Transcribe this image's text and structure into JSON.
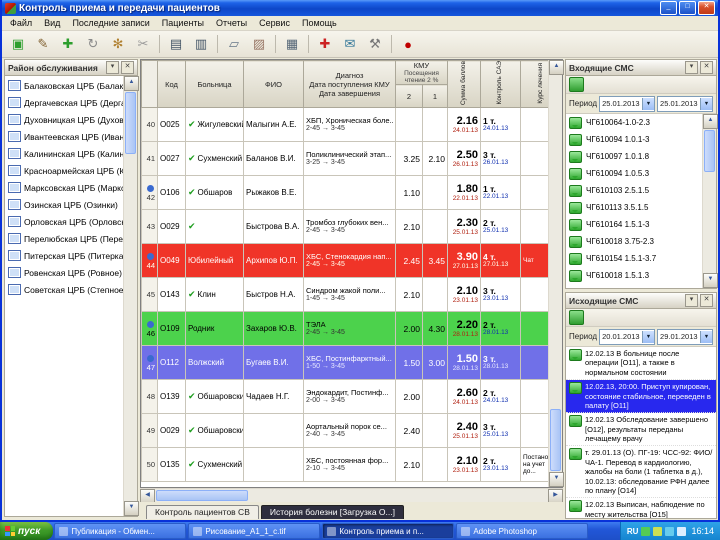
{
  "window": {
    "title": "Контроль приема и передачи пациентов",
    "controls": {
      "minimize": "_",
      "maximize": "□",
      "close": "✕"
    }
  },
  "menu": {
    "items": [
      "Файл",
      "Вид",
      "Последние записи",
      "Пациенты",
      "Отчеты",
      "Сервис",
      "Помощь"
    ]
  },
  "toolbar": {
    "icons": [
      {
        "name": "database-icon",
        "glyph": "▣",
        "color": "#2D9E2D"
      },
      {
        "name": "edit-record-icon",
        "glyph": "✎",
        "color": "#806030"
      },
      {
        "name": "add-record-icon",
        "glyph": "✚",
        "color": "#2D9E2D"
      },
      {
        "name": "refresh-icon",
        "glyph": "↻",
        "color": "#8A8A8A"
      },
      {
        "name": "wand-icon",
        "glyph": "✻",
        "color": "#B08030"
      },
      {
        "name": "cut-icon",
        "glyph": "✂",
        "color": "#999999"
      },
      {
        "name": "print-icon",
        "glyph": "▤",
        "color": "#445566"
      },
      {
        "name": "print-preview-icon",
        "glyph": "▥",
        "color": "#445566"
      },
      {
        "name": "copy-icon",
        "glyph": "▱",
        "color": "#667788"
      },
      {
        "name": "paste-icon",
        "glyph": "▨",
        "color": "#997766"
      },
      {
        "name": "card-view-icon",
        "glyph": "▦",
        "color": "#556677"
      },
      {
        "name": "first-aid-icon",
        "glyph": "✚",
        "color": "#CC2222"
      },
      {
        "name": "mail-icon",
        "glyph": "✉",
        "color": "#337799"
      },
      {
        "name": "tools-icon",
        "glyph": "⚒",
        "color": "#777777"
      },
      {
        "name": "stop-icon",
        "glyph": "●",
        "color": "#C00000"
      }
    ]
  },
  "left_panel": {
    "title": "Район обслуживания",
    "items": [
      "Балаковская ЦРБ (Балаково)",
      "Дергачевская ЦРБ (Дергачи)",
      "Духовницкая ЦРБ (Духовницкое)",
      "Ивантеевская ЦРБ (Ивантеевка)",
      "Калининская ЦРБ (Калининск)",
      "Красноармейская ЦРБ (Красноарм.)",
      "Марксовская ЦРБ (Маркс)",
      "Озинская ЦРБ (Озинки)",
      "Орловская ЦРБ (Орловское)",
      "Перелюбская ЦРБ (Перелюб)",
      "Питерская ЦРБ (Питерка)",
      "Ровенская ЦРБ (Ровное)",
      "Советская ЦРБ (Степное)"
    ]
  },
  "table": {
    "highlight_colors": {
      "red": "#F03428",
      "green": "#4CD24C",
      "blue": "#7070E8"
    },
    "header": {
      "num": "",
      "code": "Код",
      "hospital": "Больница",
      "fio": "ФИО",
      "diagnosis": "Диагноз\nДата поступления КМУ\nДата завершения",
      "kmu_group": "КМУ",
      "kmu_sub": "Посещения чтение 2 %",
      "kmu2": "2",
      "kmu1": "1",
      "score": "Сумма баллов",
      "tariff": "Контроль САЭ",
      "extra": "Курс лечения"
    },
    "rows": [
      {
        "num": "40",
        "icon": false,
        "code": "О025",
        "check": true,
        "hospital": "Жигулевский",
        "fio": "Малыгин А.Е.",
        "diagnosis": "ХБП, Хроническая боле...",
        "dates": "2-45 → 3-45",
        "kmu2": "",
        "kmu1": "",
        "score": "2.16",
        "score_date": "24.01.13",
        "tariff": "1 т.",
        "tariff_date": "24.01.13",
        "extra": "",
        "hl": ""
      },
      {
        "num": "41",
        "icon": false,
        "code": "О027",
        "check": true,
        "hospital": "Сухменский",
        "fio": "Баланов В.И.",
        "diagnosis": "Поликлинический этап...",
        "dates": "3-25 → 3-45",
        "kmu2": "3.25",
        "kmu1": "2.10",
        "score": "2.50",
        "score_date": "26.01.13",
        "tariff": "3 т.",
        "tariff_date": "26.01.13",
        "extra": "",
        "hl": ""
      },
      {
        "num": "42",
        "icon": true,
        "code": "О106",
        "check": true,
        "hospital": "Обшаров",
        "fio": "Рыжаков В.Е.",
        "diagnosis": "",
        "dates": "",
        "kmu2": "1.10",
        "kmu1": "",
        "score": "1.80",
        "score_date": "22.01.13",
        "tariff": "1 т.",
        "tariff_date": "22.01.13",
        "extra": "",
        "hl": ""
      },
      {
        "num": "43",
        "icon": false,
        "code": "О029",
        "check": true,
        "hospital": "",
        "fio": "Быстрова В.А.",
        "diagnosis": "Тромбоз глубоких вен...",
        "dates": "2-45 → 3-45",
        "kmu2": "2.10",
        "kmu1": "",
        "score": "2.30",
        "score_date": "25.01.13",
        "tariff": "2 т.",
        "tariff_date": "25.01.13",
        "extra": "",
        "hl": ""
      },
      {
        "num": "44",
        "icon": true,
        "code": "О049",
        "check": false,
        "hospital": "Юбилейный",
        "fio": "Архипов Ю.П.",
        "diagnosis": "ХБС, Стенокардия нап...",
        "dates": "2-45 → 3-45",
        "kmu2": "2.45",
        "kmu1": "3.45",
        "score": "3.90",
        "score_date": "27.01.13",
        "tariff": "4 т.",
        "tariff_date": "27.01.13",
        "extra": "Чат",
        "hl": "red"
      },
      {
        "num": "45",
        "icon": false,
        "code": "О143",
        "check": true,
        "hospital": "Клин",
        "fio": "Быстров Н.А.",
        "diagnosis": "Синдром жакой поли...",
        "dates": "1-45 → 3-45",
        "kmu2": "2.10",
        "kmu1": "",
        "score": "2.10",
        "score_date": "23.01.13",
        "tariff": "3 т.",
        "tariff_date": "23.01.13",
        "extra": "",
        "hl": ""
      },
      {
        "num": "46",
        "icon": true,
        "code": "О109",
        "check": false,
        "hospital": "Родник",
        "fio": "Захаров Ю.В.",
        "diagnosis": "ТЭЛА",
        "dates": "2-45 → 3-45",
        "kmu2": "2.00",
        "kmu1": "4.30",
        "score": "2.20",
        "score_date": "28.01.13",
        "tariff": "2 т.",
        "tariff_date": "28.01.13",
        "extra": "",
        "hl": "green"
      },
      {
        "num": "47",
        "icon": true,
        "code": "О112",
        "check": false,
        "hospital": "Волжский",
        "fio": "Бугаев В.И.",
        "diagnosis": "ХБС, Постинфарктный...",
        "dates": "1-50 → 3-45",
        "kmu2": "1.50",
        "kmu1": "3.00",
        "score": "1.50",
        "score_date": "28.01.13",
        "tariff": "3 т.",
        "tariff_date": "28.01.13",
        "extra": "",
        "hl": "blue"
      },
      {
        "num": "48",
        "icon": false,
        "code": "О139",
        "check": true,
        "hospital": "Обшаровский",
        "fio": "Чадаев Н.Г.",
        "diagnosis": "Эндокардит, Постинф...",
        "dates": "2-00 → 3-45",
        "kmu2": "2.00",
        "kmu1": "",
        "score": "2.60",
        "score_date": "24.01.13",
        "tariff": "2 т.",
        "tariff_date": "24.01.13",
        "extra": "",
        "hl": ""
      },
      {
        "num": "49",
        "icon": false,
        "code": "О029",
        "check": true,
        "hospital": "Обшаровский",
        "fio": "",
        "diagnosis": "Аортальный порок се...",
        "dates": "2-40 → 3-45",
        "kmu2": "2.40",
        "kmu1": "",
        "score": "2.40",
        "score_date": "25.01.13",
        "tariff": "3 т.",
        "tariff_date": "25.01.13",
        "extra": "",
        "hl": ""
      },
      {
        "num": "50",
        "icon": false,
        "code": "О135",
        "check": true,
        "hospital": "Сухменский",
        "fio": "",
        "diagnosis": "ХБС, постоянная фор...",
        "dates": "2-10 → 3-45",
        "kmu2": "2.10",
        "kmu1": "",
        "score": "2.10",
        "score_date": "23.01.13",
        "tariff": "2 т.",
        "tariff_date": "23.01.13",
        "extra": "Постановка на учет до...",
        "hl": ""
      }
    ]
  },
  "tabs": [
    {
      "label": "Контроль пациентов СВ",
      "active": false
    },
    {
      "label": "История болезни [Загрузка О...]",
      "active": true
    }
  ],
  "incoming_sms": {
    "title": "Входящие СМС",
    "period_label": "Период",
    "date_from": "25.01.2013",
    "date_to": "25.01.2013",
    "items": [
      "ЧГ610064-1.0-2.3",
      "ЧГ610094 1.0.1-3",
      "ЧГ610097 1.0.1.8",
      "ЧГ610094 1.0.5.3",
      "ЧГ610103 2.5.1.5",
      "ЧГ610113 3.5.1.5",
      "ЧГ610164 1.5.1-3",
      "ЧГ610018 3.75-2.3",
      "ЧГ610154 1.5.1-3.7",
      "ЧГ610018 1.5.1.3"
    ]
  },
  "outgoing_sms": {
    "title": "Исходящие СМС",
    "period_label": "Период",
    "date_from": "20.01.2013",
    "date_to": "29.01.2013",
    "items": [
      {
        "text": "12.02.13 В больнице после операции [О11], а также в нормальном состоянии",
        "selected": false
      },
      {
        "text": "12.02.13, 20:00. Приступ купирован, состояние стабильное, переведен в палату [О11]",
        "selected": true
      },
      {
        "text": "12.02.13 Обследование завершено [О12], результаты переданы лечащему врачу",
        "selected": false
      },
      {
        "text": "т. 29.01.13 (О). ПГ-19: ЧСС-92: ФИО/ЧА-1. Перевод в кардиологию, жалобы на боли (1 таблетка в д.), 10.02.13: обследование РФН далее по плану [О14]",
        "selected": false
      },
      {
        "text": "12.02.13 Выписан, наблюдение по месту жительства [О15]",
        "selected": false
      }
    ]
  },
  "taskbar": {
    "start": "пуск",
    "buttons": [
      {
        "label": "Публикация - Обмен...",
        "active": false
      },
      {
        "label": "Рисование_А1_1_с.tif",
        "active": false
      },
      {
        "label": "Контроль приема и п...",
        "active": true
      },
      {
        "label": "Adobe Photoshop",
        "active": false
      }
    ],
    "tray": {
      "lang": "RU",
      "time": "16:14",
      "icons": [
        {
          "name": "antivirus-shield-icon",
          "color": "#55CC55"
        },
        {
          "name": "message-notify-icon",
          "color": "#CCE055"
        },
        {
          "name": "network-icon",
          "color": "#66CCEE"
        },
        {
          "name": "volume-icon",
          "color": "#DDEEFF"
        }
      ]
    }
  }
}
